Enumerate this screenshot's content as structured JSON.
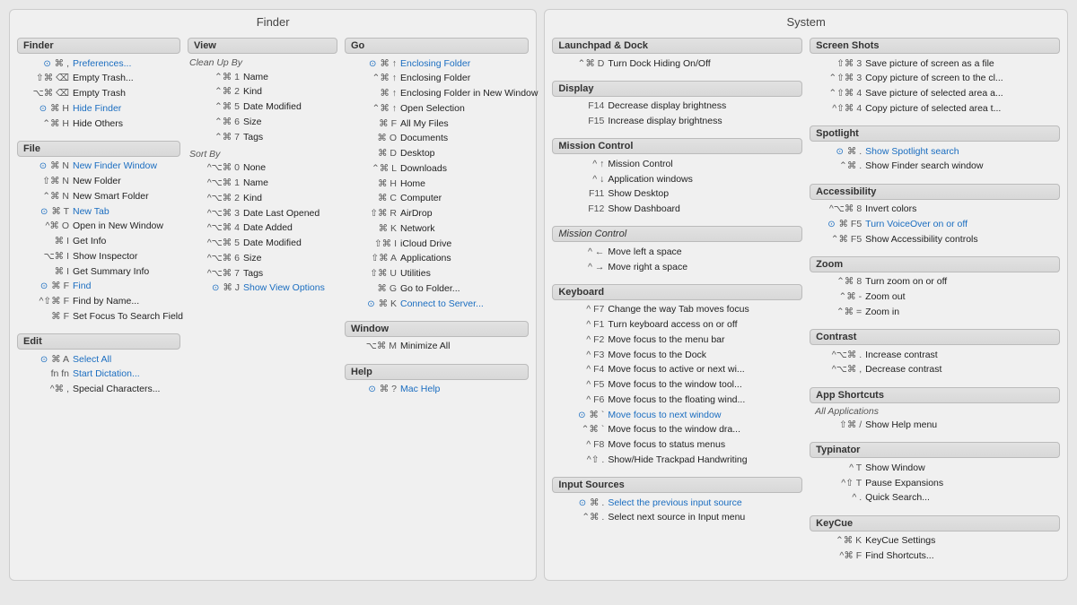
{
  "finder_panel": {
    "title": "Finder",
    "sections": {
      "finder": {
        "header": "Finder",
        "items": [
          {
            "keys": "⌘ ,",
            "label": "Preferences...",
            "blue": true,
            "dot": true
          },
          {
            "keys": "⇧⌘ ⌫",
            "label": "Empty Trash..."
          },
          {
            "keys": "⌥⌘ ⌫",
            "label": "Empty Trash"
          },
          {
            "keys": "⌥⌘ H",
            "label": "Hide Finder",
            "blue": true,
            "dot": true
          },
          {
            "keys": "⌃⌘ H",
            "label": "Hide Others"
          }
        ]
      },
      "file": {
        "header": "File",
        "items": [
          {
            "keys": "⌘ N",
            "label": "New Finder Window",
            "blue": true,
            "dot": true
          },
          {
            "keys": "⇧⌘ N",
            "label": "New Folder"
          },
          {
            "keys": "⌃⌘ N",
            "label": "New Smart Folder"
          },
          {
            "keys": "⌘ T",
            "label": "New Tab",
            "blue": true,
            "dot": true
          },
          {
            "keys": "^⌘ O",
            "label": "Open in New Window"
          },
          {
            "keys": "⌘ I",
            "label": "Get Info"
          },
          {
            "keys": "⌥⌘ I",
            "label": "Show Inspector"
          },
          {
            "keys": "⌘ I",
            "label": "Get Summary Info"
          },
          {
            "keys": "⌘ F",
            "label": "Find",
            "blue": true,
            "dot": true
          },
          {
            "keys": "⌃⇧⌘ F",
            "label": "Find by Name..."
          },
          {
            "keys": "⌘ F",
            "label": "Set Focus To Search Field"
          }
        ]
      },
      "edit": {
        "header": "Edit",
        "items": [
          {
            "keys": "⌘ A",
            "label": "Select All",
            "blue": true,
            "dot": true
          },
          {
            "keys": "fn fn",
            "label": "Start Dictation...",
            "blue": true
          },
          {
            "keys": "^⌘ ,",
            "label": "Special Characters..."
          }
        ]
      }
    },
    "view_col": {
      "view": {
        "header": "View",
        "subsections": [
          {
            "sub_header": "Clean Up By",
            "italic": true,
            "items": [
              {
                "keys": "⌃⌘ 1",
                "label": "Name"
              },
              {
                "keys": "⌃⌘ 2",
                "label": "Kind"
              },
              {
                "keys": "⌃⌘ 5",
                "label": "Date Modified"
              },
              {
                "keys": "⌃⌘ 6",
                "label": "Size"
              },
              {
                "keys": "⌃⌘ 7",
                "label": "Tags"
              }
            ]
          },
          {
            "sub_header": "Sort By",
            "italic": true,
            "items": [
              {
                "keys": "^⌥⌘ 0",
                "label": "None"
              },
              {
                "keys": "^⌥⌘ 1",
                "label": "Name"
              },
              {
                "keys": "^⌥⌘ 2",
                "label": "Kind"
              },
              {
                "keys": "^⌥⌘ 3",
                "label": "Date Last Opened"
              },
              {
                "keys": "^⌥⌘ 4",
                "label": "Date Added"
              },
              {
                "keys": "^⌥⌘ 5",
                "label": "Date Modified"
              },
              {
                "keys": "^⌥⌘ 6",
                "label": "Size"
              },
              {
                "keys": "^⌥⌘ 7",
                "label": "Tags"
              },
              {
                "keys": "⌘ J",
                "label": "Show View Options",
                "blue": true,
                "dot": true
              }
            ]
          }
        ]
      }
    },
    "go_col": {
      "go": {
        "header": "Go",
        "items": [
          {
            "keys": "⌘ ↑",
            "label": "Enclosing Folder",
            "blue": true,
            "dot": true
          },
          {
            "keys": "⌃⌘ ↑",
            "label": "Enclosing Folder"
          },
          {
            "keys": "⌘ ↑",
            "label": "Enclosing Folder in New Window"
          },
          {
            "keys": "⌃⌘ ↑",
            "label": "Open Selection"
          },
          {
            "keys": "⌘ F",
            "label": "All My Files"
          },
          {
            "keys": "⌘ O",
            "label": "Documents"
          },
          {
            "keys": "⌘ D",
            "label": "Desktop"
          },
          {
            "keys": "⌃⌘ L",
            "label": "Downloads"
          },
          {
            "keys": "⌘ H",
            "label": "Home"
          },
          {
            "keys": "⌘ C",
            "label": "Computer"
          },
          {
            "keys": "⇧⌘ R",
            "label": "AirDrop"
          },
          {
            "keys": "⌘ K",
            "label": "Network"
          },
          {
            "keys": "⇧⌘ I",
            "label": "iCloud Drive"
          },
          {
            "keys": "⇧⌘ A",
            "label": "Applications"
          },
          {
            "keys": "⇧⌘ U",
            "label": "Utilities"
          },
          {
            "keys": "⌘ G",
            "label": "Go to Folder..."
          },
          {
            "keys": "⌘ K",
            "label": "Connect to Server...",
            "blue": true,
            "dot": true
          }
        ]
      },
      "window": {
        "header": "Window",
        "items": [
          {
            "keys": "⌥⌘ M",
            "label": "Minimize All"
          }
        ]
      },
      "help": {
        "header": "Help",
        "items": [
          {
            "keys": "⌘ ?",
            "label": "Mac Help",
            "blue": true,
            "dot": true
          }
        ]
      }
    }
  },
  "system_panel": {
    "title": "System",
    "sections": {
      "launchpad": {
        "header": "Launchpad & Dock",
        "items": [
          {
            "keys": "⌃⌘ D",
            "label": "Turn Dock Hiding On/Off"
          }
        ]
      },
      "display": {
        "header": "Display",
        "items": [
          {
            "keys": "F14",
            "label": "Decrease display brightness"
          },
          {
            "keys": "F15",
            "label": "Increase display brightness"
          }
        ]
      },
      "mission_control": {
        "header": "Mission Control",
        "items": [
          {
            "keys": "^ ↑",
            "label": "Mission Control"
          },
          {
            "keys": "^ ↓",
            "label": "Application windows"
          },
          {
            "keys": "F11",
            "label": "Show Desktop"
          },
          {
            "keys": "F12",
            "label": "Show Dashboard"
          }
        ]
      },
      "mission_control2": {
        "header": "Mission Control",
        "italic": true,
        "items": [
          {
            "keys": "^ ←",
            "label": "Move left a space"
          },
          {
            "keys": "^ →",
            "label": "Move right a space"
          }
        ]
      },
      "keyboard": {
        "header": "Keyboard",
        "items": [
          {
            "keys": "^ F7",
            "label": "Change the way Tab moves focus"
          },
          {
            "keys": "^ F1",
            "label": "Turn keyboard access on or off"
          },
          {
            "keys": "^ F2",
            "label": "Move focus to the menu bar"
          },
          {
            "keys": "^ F3",
            "label": "Move focus to the Dock"
          },
          {
            "keys": "^ F4",
            "label": "Move focus to active or next wi..."
          },
          {
            "keys": "^ F5",
            "label": "Move focus to the window tool..."
          },
          {
            "keys": "^ F6",
            "label": "Move focus to the floating wind..."
          },
          {
            "keys": "⌘ `",
            "label": "Move focus to next window",
            "blue": true,
            "dot": true
          },
          {
            "keys": "⌃⌘ `",
            "label": "Move focus to the window dra..."
          },
          {
            "keys": "^ F8",
            "label": "Move focus to status menus"
          },
          {
            "keys": "^⇧ .",
            "label": "Show/Hide Trackpad Handwriting"
          }
        ]
      },
      "input_sources": {
        "header": "Input Sources",
        "items": [
          {
            "keys": "⌘ .",
            "label": "Select the previous input source",
            "blue": true,
            "dot": true
          },
          {
            "keys": "⌃⌘ .",
            "label": "Select next source in Input menu"
          }
        ]
      }
    },
    "right_col": {
      "screenshots": {
        "header": "Screen Shots",
        "items": [
          {
            "keys": "⇧⌘ 3",
            "label": "Save picture of screen as a file"
          },
          {
            "keys": "⌃⇧⌘ 3",
            "label": "Copy picture of screen to the cl..."
          },
          {
            "keys": "⌃⇧⌘ 4",
            "label": "Save picture of selected area a..."
          },
          {
            "keys": "^⇧⌘ 4",
            "label": "Copy picture of selected area t..."
          }
        ]
      },
      "spotlight": {
        "header": "Spotlight",
        "items": [
          {
            "keys": "⌘ .",
            "label": "Show Spotlight search",
            "blue": true,
            "dot": true
          },
          {
            "keys": "⌃⌘ .",
            "label": "Show Finder search window"
          }
        ]
      },
      "accessibility": {
        "header": "Accessibility",
        "items": [
          {
            "keys": "^⌥⌘ 8",
            "label": "Invert colors"
          },
          {
            "keys": "⌘ F5",
            "label": "Turn VoiceOver on or off",
            "blue": true,
            "dot": true
          },
          {
            "keys": "⌃⌘ F5",
            "label": "Show Accessibility controls"
          }
        ]
      },
      "zoom": {
        "header": "Zoom",
        "items": [
          {
            "keys": "⌃⌘ 8",
            "label": "Turn zoom on or off"
          },
          {
            "keys": "⌃⌘ -",
            "label": "Zoom out"
          },
          {
            "keys": "⌃⌘ =",
            "label": "Zoom in"
          }
        ]
      },
      "contrast": {
        "header": "Contrast",
        "items": [
          {
            "keys": "^⌥⌘ .",
            "label": "Increase contrast"
          },
          {
            "keys": "^⌥⌘ ,",
            "label": "Decrease contrast"
          }
        ]
      },
      "app_shortcuts": {
        "header": "App Shortcuts",
        "all_apps_label": "All Applications",
        "items": [
          {
            "keys": "⇧⌘ /",
            "label": "Show Help menu"
          }
        ]
      },
      "typinator": {
        "header": "Typinator",
        "items": [
          {
            "keys": "^ T",
            "label": "Show Window"
          },
          {
            "keys": "^⇧ T",
            "label": "Pause Expansions"
          },
          {
            "keys": "^ .",
            "label": "Quick Search..."
          }
        ]
      },
      "keycue": {
        "header": "KeyCue",
        "items": [
          {
            "keys": "⌃⌘ K",
            "label": "KeyCue Settings"
          },
          {
            "keys": "^⌘ F",
            "label": "Find Shortcuts..."
          }
        ]
      }
    }
  }
}
